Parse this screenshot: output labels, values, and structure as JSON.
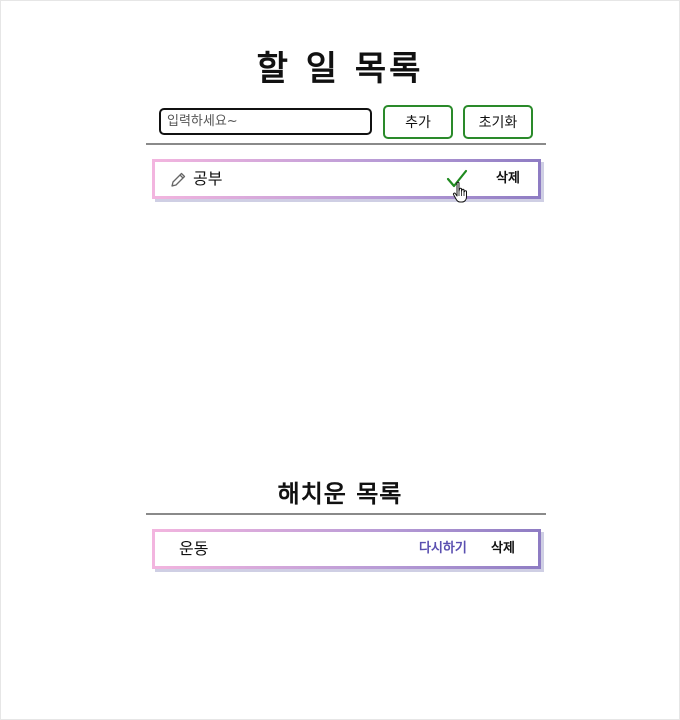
{
  "main": {
    "title": "할 일 목록",
    "input_placeholder": "입력하세요~",
    "add_label": "추가",
    "reset_label": "초기화"
  },
  "todos": [
    {
      "text": "공부",
      "delete_label": "삭제"
    }
  ],
  "done": {
    "title": "해치운 목록",
    "items": [
      {
        "text": "운동",
        "redo_label": "다시하기",
        "delete_label": "삭제"
      }
    ]
  },
  "colors": {
    "button_border": "#2a8a2a",
    "checkmark": "#1f8a1f",
    "redo_text": "#5a4fb0",
    "card_gradient_start": "#f3b5df",
    "card_gradient_end": "#8e7cc3",
    "divider": "#8a8a8a"
  },
  "icons": {
    "edit": "pencil-icon",
    "complete": "checkmark-icon",
    "cursor": "hand-pointer-icon"
  }
}
